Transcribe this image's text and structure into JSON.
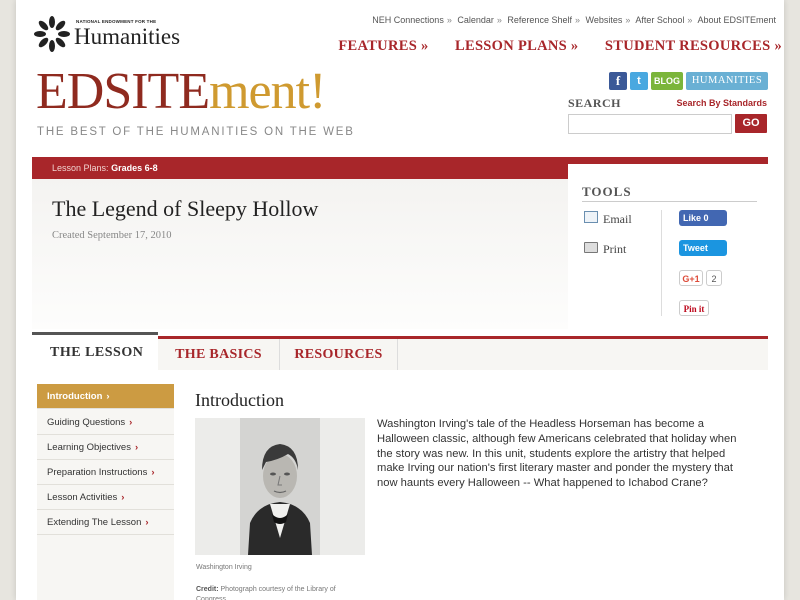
{
  "header": {
    "neh_small": "NATIONAL ENDOWMENT FOR THE",
    "neh_word": "Humanities",
    "top_links": [
      "NEH Connections",
      "Calendar",
      "Reference Shelf",
      "Websites",
      "After School",
      "About EDSITEment"
    ],
    "main_nav": [
      "FEATURES »",
      "LESSON PLANS »",
      "STUDENT RESOURCES »"
    ],
    "brand_a": "EDSITE",
    "brand_b": "ment!",
    "tagline": "THE BEST OF THE HUMANITIES ON THE WEB",
    "social": {
      "facebook": "f",
      "twitter": "t",
      "blog": "BLOG",
      "humanities": "HUMANITIES"
    },
    "search": {
      "label": "SEARCH",
      "by_standards": "Search By Standards",
      "go": "GO",
      "placeholder": ""
    }
  },
  "breadcrumb": {
    "label": "Lesson Plans:",
    "value": "Grades 6-8"
  },
  "lesson": {
    "title": "The Legend of Sleepy Hollow",
    "created": "Created September 17, 2010"
  },
  "tools": {
    "heading": "TOOLS",
    "email": "Email",
    "print": "Print",
    "fb_like": "Like 0",
    "tweet": "Tweet",
    "gplus": "G+1",
    "gplus_count": "2",
    "pinit": "Pin it"
  },
  "tabs": [
    "THE LESSON",
    "THE BASICS",
    "RESOURCES"
  ],
  "leftnav": [
    "Introduction",
    "Guiding Questions",
    "Learning Objectives",
    "Preparation Instructions",
    "Lesson Activities",
    "Extending The Lesson"
  ],
  "leftnav_chevron": "›",
  "content": {
    "heading": "Introduction",
    "caption": "Washington Irving",
    "credit_label": "Credit:",
    "credit_text": "Photograph courtesy of the Library of Congress.",
    "intro": "Washington Irving's tale of the Headless Horseman has become a Halloween classic, although few Americans celebrated that holiday when the story was new. In this unit, students explore the artistry that helped make Irving our nation's first literary master and ponder the mystery that now haunts every Halloween -- What happened to Ichabod Crane?"
  },
  "colors": {
    "brand_red": "#a8262a",
    "brand_gold": "#cf9a30",
    "nav_active": "#cc9b42"
  }
}
